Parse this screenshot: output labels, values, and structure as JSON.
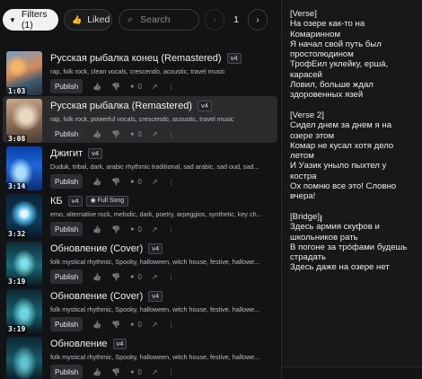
{
  "toolbar": {
    "filters_label": "Filters (1)",
    "liked_label": "Liked",
    "search_placeholder": "Search",
    "page_number": "1"
  },
  "icons": {
    "filter": "funnel-icon",
    "liked": "thumbs-up-icon",
    "search": "search-icon",
    "prev": "chevron-left-icon",
    "next": "chevron-right-icon",
    "like": "thumbs-up-icon",
    "dislike": "thumbs-down-icon",
    "comment": "comment-icon",
    "share": "share-icon",
    "more": "more-vertical-icon"
  },
  "songs": [
    {
      "title": "Русская рыбалка конец (Remastered)",
      "version": "v4",
      "full_song": "",
      "tags": "rap, folk rock, clean vocals, crescendo, acoustic, travel music",
      "duration": "1:03",
      "comments": "0",
      "publish_label": "Publish",
      "selected": false
    },
    {
      "title": "Русская рыбалка (Remastered)",
      "version": "v4",
      "full_song": "",
      "tags": "rap, folk rock, powerful vocals, crescendo, acoustic, travel music",
      "duration": "3:08",
      "comments": "0",
      "publish_label": "Publish",
      "selected": true
    },
    {
      "title": "Джигит",
      "version": "v4",
      "full_song": "",
      "tags": "Duduk, tribal, dark, arabic rhythmic traditional, sad arabic, sad oud, sad...",
      "duration": "3:14",
      "comments": "0",
      "publish_label": "Publish",
      "selected": false
    },
    {
      "title": "КБ",
      "version": "v4",
      "full_song": "Full Song",
      "tags": "emo, alternative rock, melodic, dark, poetry, arpeggios, synthetic, key ch...",
      "duration": "3:32",
      "comments": "0",
      "publish_label": "Publish",
      "selected": false
    },
    {
      "title": "Обновление (Cover)",
      "version": "v4",
      "full_song": "",
      "tags": "folk mystical rhythmic, Spooky, halloween, witch house, festive, hallowe...",
      "duration": "3:19",
      "comments": "0",
      "publish_label": "Publish",
      "selected": false
    },
    {
      "title": "Обновление (Cover)",
      "version": "v4",
      "full_song": "",
      "tags": "folk mystical rhythmic, Spooky, halloween, witch house, festive, hallowe...",
      "duration": "3:19",
      "comments": "0",
      "publish_label": "Publish",
      "selected": false
    },
    {
      "title": "Обновление",
      "version": "v4",
      "full_song": "",
      "tags": "folk mystical rhythmic, Spooky, halloween, witch house, festive, hallowe...",
      "duration": "",
      "comments": "0",
      "publish_label": "Publish",
      "selected": false
    }
  ],
  "lyrics": [
    "[Verse]",
    "На озере как-то на",
    "Комаринном",
    "Я начал свой путь был",
    "простолюдином",
    "ТрофЕил уклейку, ершá,",
    "карасей",
    "Ловил, больше ждал",
    "здоровенных язей",
    "",
    "[Verse 2]",
    "Сидел днем за днем я на",
    "озере этом",
    "Комар не кусал хотя дело",
    "летом",
    "И Уазик уныло пыхтел у",
    "костра",
    "Ох помню все это! Словно",
    "вчера!",
    "",
    "[Bridge]",
    "Здесь армия скуфов и",
    "школьников рать",
    "В погоне за трóфами будешь",
    "страдать",
    "Здесь даже на озере нет"
  ],
  "colors": {
    "background": "#121214",
    "selected_row": "#2b2b2e",
    "lyrics_panel": "#18181b",
    "filters_button": "#f1f1f2"
  }
}
